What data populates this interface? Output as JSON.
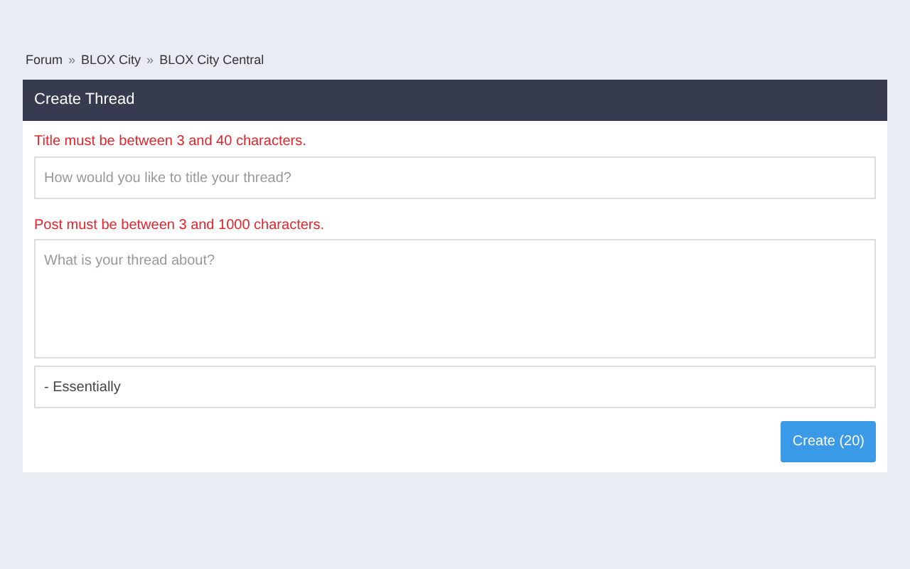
{
  "breadcrumb": {
    "separator": "»",
    "items": [
      "Forum",
      "BLOX City",
      "BLOX City Central"
    ]
  },
  "panel": {
    "title": "Create Thread"
  },
  "title_field": {
    "error": "Title must be between 3 and 40 characters.",
    "placeholder": "How would you like to title your thread?"
  },
  "post_field": {
    "error": "Post must be between 3 and 1000 characters.",
    "placeholder": "What is your thread about?"
  },
  "category_field": {
    "value": "- Essentially"
  },
  "submit_button": {
    "label": "Create (20)"
  }
}
